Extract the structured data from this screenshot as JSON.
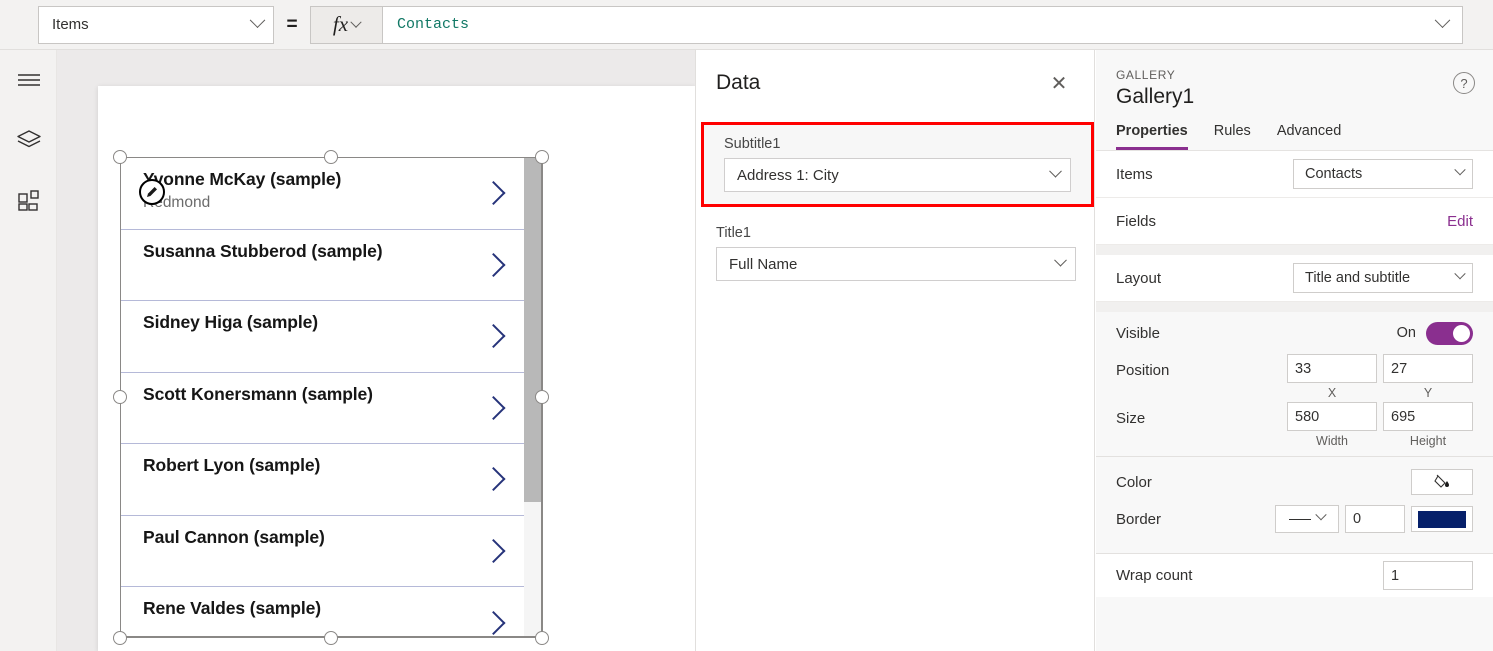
{
  "formula_bar": {
    "property_selected": "Items",
    "equals": "=",
    "fx_label": "fx",
    "formula_value": "Contacts"
  },
  "left_rail": {
    "items": [
      {
        "icon": "hamburger-menu-icon",
        "name": "menu"
      },
      {
        "icon": "layers-icon",
        "name": "tree-view"
      },
      {
        "icon": "components-grid-icon",
        "name": "insert"
      }
    ]
  },
  "canvas": {
    "gallery": {
      "rows": [
        {
          "title": "Yvonne McKay (sample)",
          "subtitle": "Redmond"
        },
        {
          "title": "Susanna Stubberod (sample)",
          "subtitle": ""
        },
        {
          "title": "Sidney Higa (sample)",
          "subtitle": ""
        },
        {
          "title": "Scott Konersmann (sample)",
          "subtitle": ""
        },
        {
          "title": "Robert Lyon (sample)",
          "subtitle": ""
        },
        {
          "title": "Paul Cannon (sample)",
          "subtitle": ""
        },
        {
          "title": "Rene Valdes (sample)",
          "subtitle": ""
        }
      ]
    }
  },
  "data_panel": {
    "title": "Data",
    "close_label": "✕",
    "fields": [
      {
        "label": "Subtitle1",
        "value": "Address 1: City",
        "highlighted": true
      },
      {
        "label": "Title1",
        "value": "Full Name",
        "highlighted": false
      }
    ]
  },
  "properties_panel": {
    "eyebrow": "GALLERY",
    "title": "Gallery1",
    "help_label": "?",
    "tabs": [
      {
        "label": "Properties",
        "active": true
      },
      {
        "label": "Rules",
        "active": false
      },
      {
        "label": "Advanced",
        "active": false
      }
    ],
    "items_label": "Items",
    "items_value": "Contacts",
    "fields_label": "Fields",
    "fields_edit_label": "Edit",
    "layout_label": "Layout",
    "layout_value": "Title and subtitle",
    "visible_label": "Visible",
    "visible_state": "On",
    "position_label": "Position",
    "position_x": "33",
    "position_y": "27",
    "position_x_caption": "X",
    "position_y_caption": "Y",
    "size_label": "Size",
    "size_width": "580",
    "size_height": "695",
    "size_width_caption": "Width",
    "size_height_caption": "Height",
    "color_label": "Color",
    "border_label": "Border",
    "border_width": "0",
    "border_color": "#06206A",
    "wrap_count_label": "Wrap count",
    "wrap_count_value": "1"
  },
  "colors": {
    "accent_purple": "#8A2F8F",
    "formula_text": "#117865",
    "highlight_red": "#FF0000",
    "chevron_blue": "#26337A",
    "border_navy": "#06206A"
  }
}
